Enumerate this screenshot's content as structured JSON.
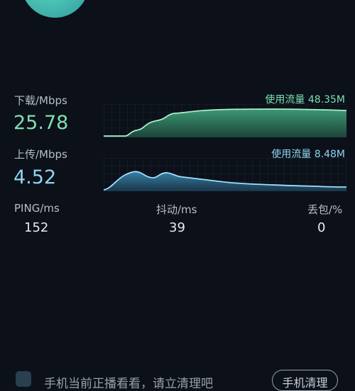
{
  "download": {
    "label": "下载/Mbps",
    "value": "25.78",
    "usage": "使用流量 48.35M"
  },
  "upload": {
    "label": "上传/Mbps",
    "value": "4.52",
    "usage": "使用流量 8.48M"
  },
  "stats": {
    "ping_label": "PING/ms",
    "ping_value": "152",
    "jitter_label": "抖动/ms",
    "jitter_value": "39",
    "loss_label": "丢包/%",
    "loss_value": "0"
  },
  "bottom": {
    "text": "手机当前正播看看，请立清理吧",
    "button": "手机清理"
  },
  "colors": {
    "background": "#0b1019",
    "download": "#7ee0b0",
    "upload": "#8fd4f2"
  }
}
